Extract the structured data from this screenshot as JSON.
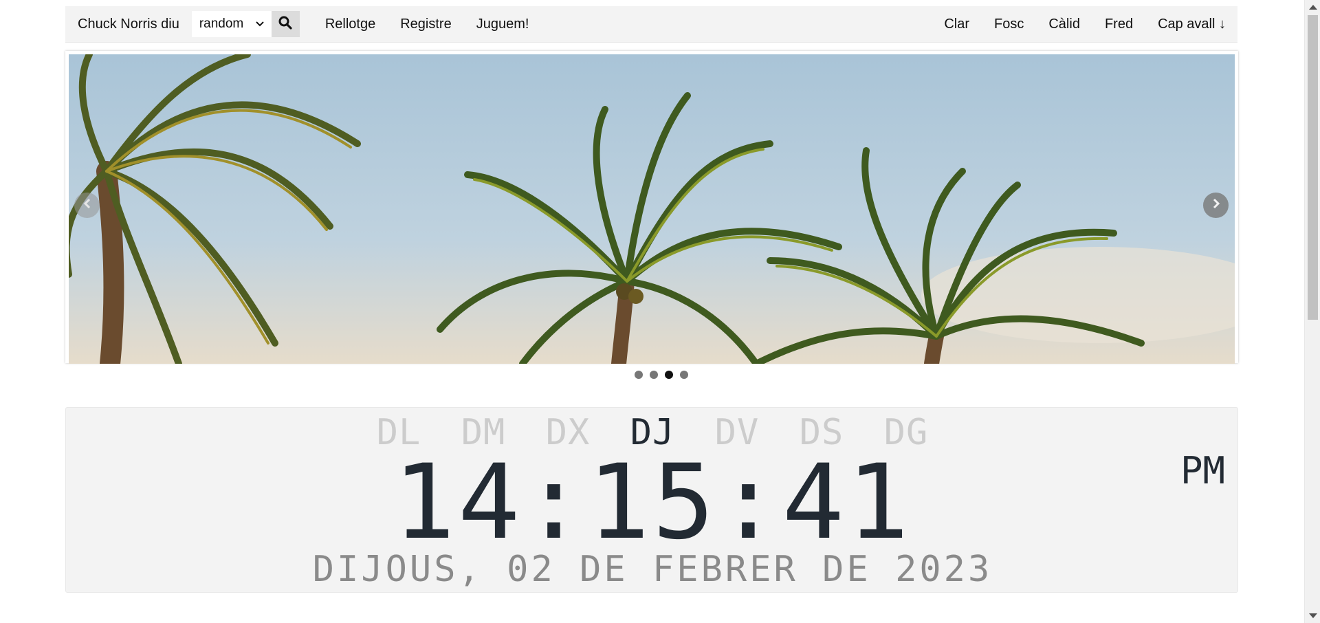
{
  "navbar": {
    "brand": "Chuck Norris diu",
    "select_value": "random",
    "search_icon": "search-icon",
    "links": [
      "Rellotge",
      "Registre",
      "Juguem!"
    ],
    "themes": [
      "Clar",
      "Fosc",
      "Càlid",
      "Fred",
      "Cap avall ↓"
    ]
  },
  "carousel": {
    "image": "palm-trees-sky",
    "dots": 4,
    "active_dot": 3
  },
  "clock": {
    "days": [
      "DL",
      "DM",
      "DX",
      "DJ",
      "DV",
      "DS",
      "DG"
    ],
    "active_day": "DJ",
    "time": "14:15:41",
    "ampm": "PM",
    "date": "DIJOUS, 02 DE FEBRER DE 2023"
  },
  "colors": {
    "navbar_bg": "#f3f3f3",
    "clock_text": "#222a33",
    "inactive_day": "#cccccc",
    "date_text": "#8a8a8a"
  }
}
